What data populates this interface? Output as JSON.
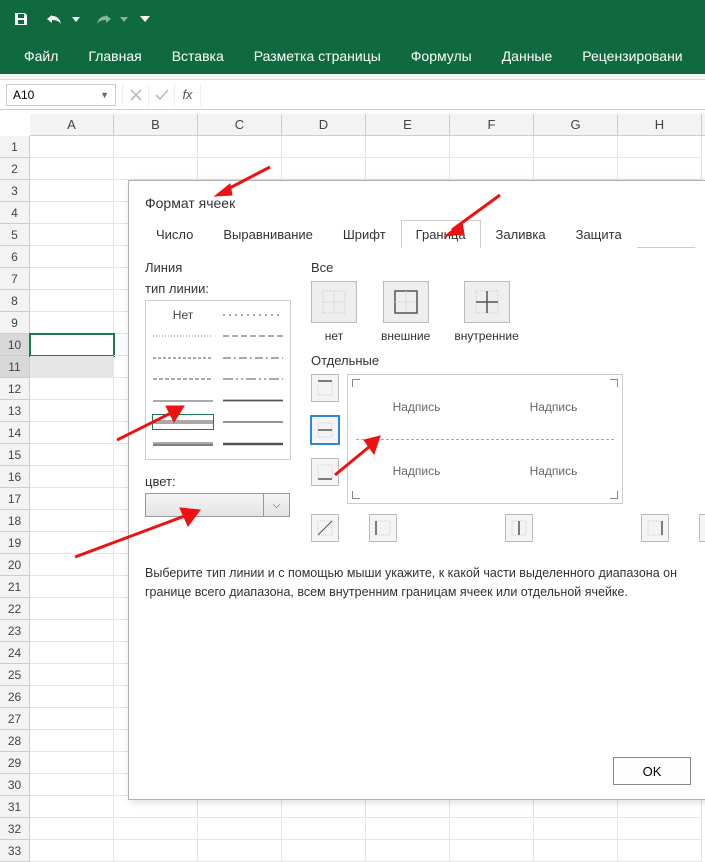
{
  "titlebar": {
    "save_icon": "save",
    "undo_icon": "undo",
    "redo_icon": "redo"
  },
  "ribbon": {
    "tabs": [
      "Файл",
      "Главная",
      "Вставка",
      "Разметка страницы",
      "Формулы",
      "Данные",
      "Рецензировани"
    ]
  },
  "namebox": {
    "value": "A10"
  },
  "columns": [
    "A",
    "B",
    "C",
    "D",
    "E",
    "F",
    "G",
    "H"
  ],
  "row_count": 33,
  "active_row": 10,
  "sel_row": 11,
  "dialog": {
    "title": "Формат ячеек",
    "tabs": [
      "Число",
      "Выравнивание",
      "Шрифт",
      "Граница",
      "Заливка",
      "Защита"
    ],
    "active_tab": 3,
    "line_group": "Линия",
    "line_type_lbl": "тип линии:",
    "none_label": "Нет",
    "color_lbl": "цвет:",
    "all_lbl": "Все",
    "presets": [
      {
        "label": "нет",
        "underline": "н"
      },
      {
        "label": "внешние",
        "underline": "в"
      },
      {
        "label": "внутренние",
        "underline": "в"
      }
    ],
    "individual_lbl": "Отдельные",
    "preview_text": "Надпись",
    "hint": "Выберите тип линии и с помощью мыши укажите, к какой части выделенного диапазона он границе всего диапазона, всем внутренним границам ячеек или отдельной ячейке.",
    "ok": "OK"
  }
}
